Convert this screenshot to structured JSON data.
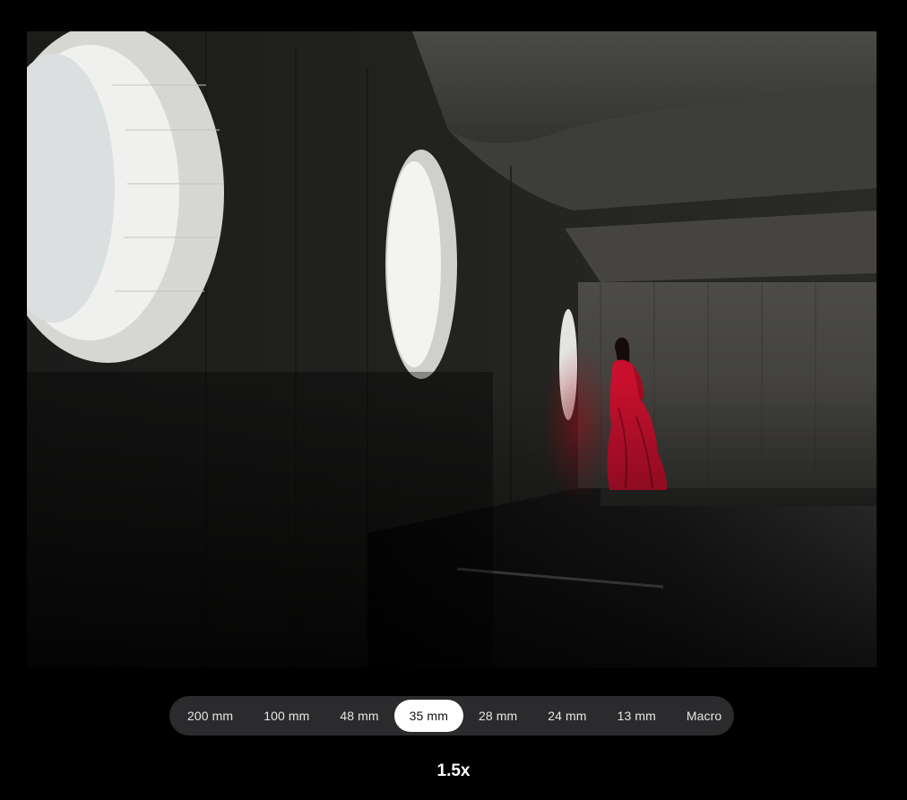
{
  "photo": {
    "subject": "woman-in-red-dress-concrete-corridor"
  },
  "lens_selector": {
    "options": [
      {
        "label": "200 mm",
        "selected": false
      },
      {
        "label": "100 mm",
        "selected": false
      },
      {
        "label": "48 mm",
        "selected": false
      },
      {
        "label": "35 mm",
        "selected": true
      },
      {
        "label": "28 mm",
        "selected": false
      },
      {
        "label": "24 mm",
        "selected": false
      },
      {
        "label": "13 mm",
        "selected": false
      },
      {
        "label": "Macro",
        "selected": false
      }
    ]
  },
  "zoom": {
    "value": "1.5x"
  },
  "colors": {
    "background": "#000000",
    "bar": "#2b2b2d",
    "selected_pill": "#ffffff",
    "dress": "#c8102e"
  }
}
